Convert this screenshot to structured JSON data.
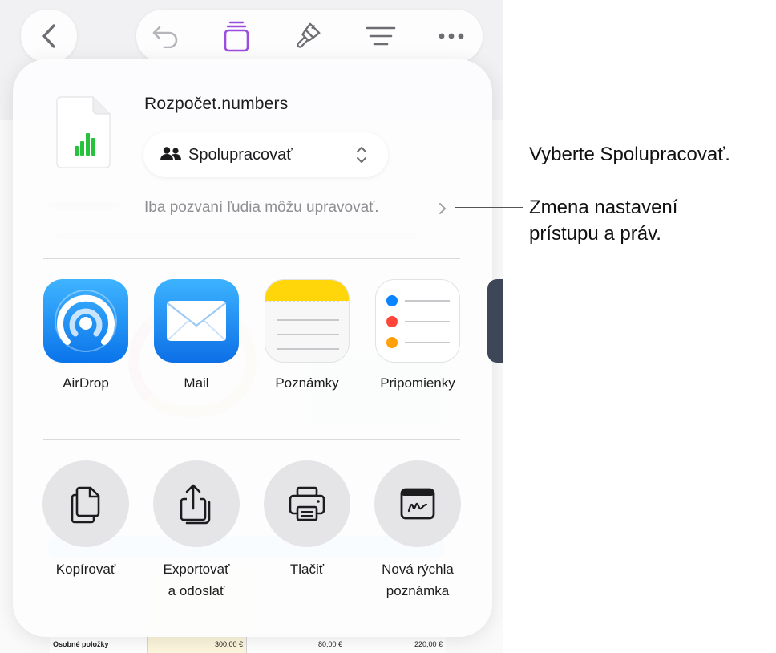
{
  "toolbar": {
    "back_icon": "chevron-left-icon",
    "undo_icon": "undo-icon",
    "collaborate_icon": "document-stack-icon",
    "format_icon": "paintbrush-icon",
    "organize_icon": "lines-icon",
    "more_icon": "ellipsis-icon",
    "accent_color": "#9b4de0"
  },
  "share_sheet": {
    "file_name": "Rozpočet.numbers",
    "collaboration_mode": "Spolupracovať",
    "permission_text": "Iba pozvaní ľudia môžu upravovať.",
    "apps": [
      {
        "label": "AirDrop",
        "icon": "airdrop-icon"
      },
      {
        "label": "Mail",
        "icon": "mail-icon"
      },
      {
        "label": "Poznámky",
        "icon": "notes-icon"
      },
      {
        "label": "Pripomienky",
        "icon": "reminders-icon"
      }
    ],
    "actions": [
      {
        "line1": "Kopírovať",
        "line2": "",
        "icon": "copy-icon"
      },
      {
        "line1": "Exportovať",
        "line2": "a odoslať",
        "icon": "export-icon"
      },
      {
        "line1": "Tlačiť",
        "line2": "",
        "icon": "printer-icon"
      },
      {
        "line1": "Nová rýchla",
        "line2": "poznámka",
        "icon": "quick-note-icon"
      }
    ]
  },
  "background_table": {
    "row_label": "Osobné položky",
    "values": [
      "300,00 €",
      "80,00 €",
      "220,00 €"
    ]
  },
  "callouts": {
    "collaborate": "Vyberte Spolupracovať.",
    "access_line1": "Zmena nastavení",
    "access_line2": "prístupu a práv."
  }
}
